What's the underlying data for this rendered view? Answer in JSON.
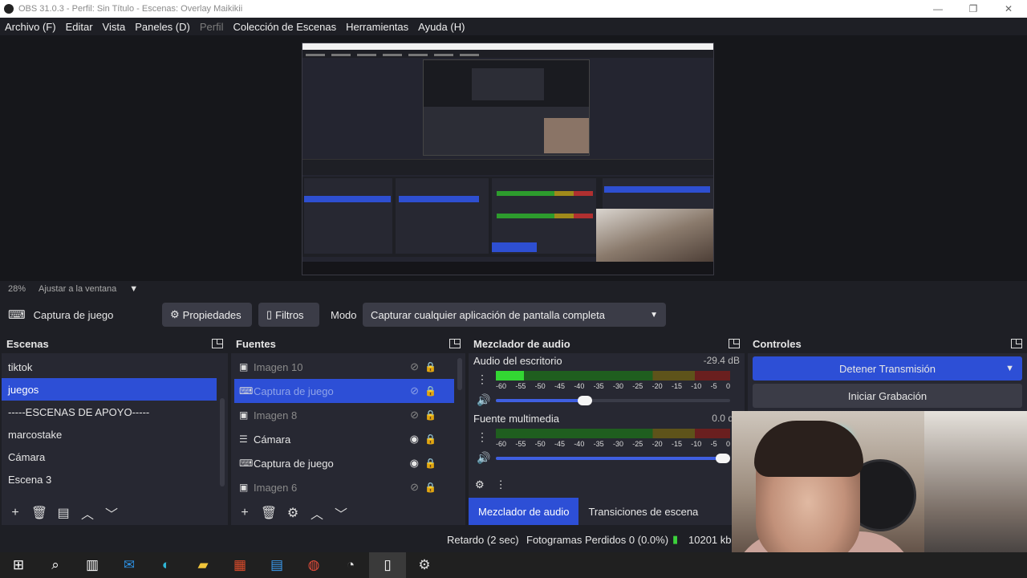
{
  "window": {
    "title": "OBS 31.0.3 - Perfil: Sin Título - Escenas: Overlay Maikikii",
    "minimize": "—",
    "restore": "❐",
    "close": "✕"
  },
  "menu": [
    "Archivo (F)",
    "Editar",
    "Vista",
    "Paneles (D)",
    "Perfil",
    "Colección de Escenas",
    "Herramientas",
    "Ayuda (H)"
  ],
  "menu_disabled_index": 4,
  "zoom": {
    "percent": "28%",
    "mode": "Ajustar a la ventana"
  },
  "source_bar": {
    "source_name": "Captura de juego",
    "properties": "Propiedades",
    "filters": "Filtros",
    "mode_label": "Modo",
    "mode_value": "Capturar cualquier aplicación de pantalla completa"
  },
  "scenes": {
    "title": "Escenas",
    "items": [
      "tiktok",
      "juegos",
      "-----ESCENAS DE APOYO-----",
      "marcostake",
      "Cámara",
      "Escena 3"
    ],
    "selected_index": 1
  },
  "sources": {
    "title": "Fuentes",
    "items": [
      {
        "name": "Imagen 10",
        "icon": "image-icon",
        "visible": false
      },
      {
        "name": "Captura de juego",
        "icon": "gamepad-icon",
        "visible": false,
        "selected": true
      },
      {
        "name": "Imagen 8",
        "icon": "image-icon",
        "visible": false
      },
      {
        "name": "Cámara",
        "icon": "list-icon",
        "visible": true
      },
      {
        "name": "Captura de juego",
        "icon": "gamepad-icon",
        "visible": true
      },
      {
        "name": "Imagen 6",
        "icon": "image-icon",
        "visible": false
      }
    ]
  },
  "mixer": {
    "title": "Mezclador de audio",
    "channels": [
      {
        "name": "Audio del escritorio",
        "db": "-29.4 dB",
        "level": 0.12,
        "volume": 0.38
      },
      {
        "name": "Fuente multimedia",
        "db": "0.0 dB",
        "level": 0.0,
        "volume": 0.97
      }
    ],
    "ticks": [
      "-60",
      "-55",
      "-50",
      "-45",
      "-40",
      "-35",
      "-30",
      "-25",
      "-20",
      "-15",
      "-10",
      "-5",
      "0"
    ],
    "tabs": [
      "Mezclador de audio",
      "Transiciones de escena"
    ]
  },
  "controls": {
    "title": "Controles",
    "stop_stream": "Detener Transmisión",
    "start_record": "Iniciar Grabación"
  },
  "status": {
    "delay": "Retardo (2 sec)",
    "dropped": "Fotogramas Perdidos 0 (0.0%)",
    "bitrate": "10201 kb"
  },
  "colors": {
    "accent": "#2d4fd6",
    "panel": "#272832",
    "background": "#1e1f25",
    "meter_green": "#33d633"
  }
}
